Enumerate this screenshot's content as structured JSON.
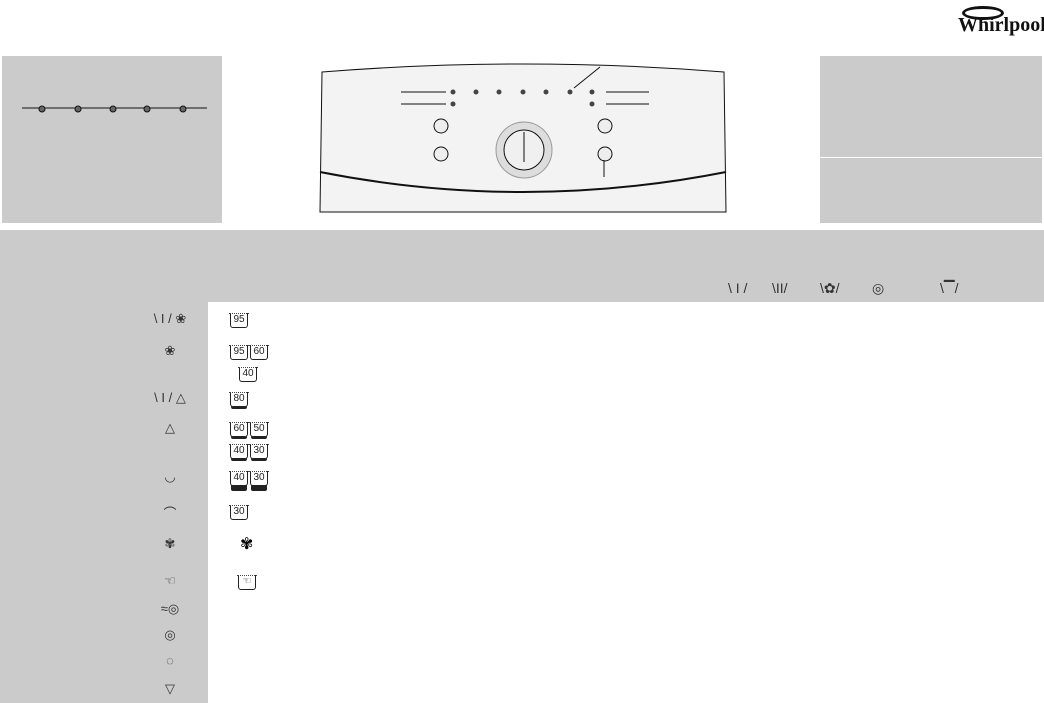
{
  "logo": {
    "text": "Whirlpool"
  },
  "program_rows": [
    {
      "icon": "cotton-prewash-icon",
      "temps": [
        [
          "95"
        ]
      ],
      "bar": ""
    },
    {
      "icon": "cotton-icon",
      "temps": [
        [
          "95",
          "60"
        ],
        [
          "40"
        ]
      ],
      "bar": ""
    },
    {
      "icon": "synthetics-prewash-icon",
      "temps": [
        [
          "80"
        ]
      ],
      "bar": "bar"
    },
    {
      "icon": "synthetics-icon",
      "temps": [
        [
          "60",
          "50"
        ],
        [
          "40",
          "30"
        ]
      ],
      "bar": "bar"
    },
    {
      "icon": "delicates-icon",
      "temps": [
        [
          "40",
          "30"
        ]
      ],
      "bar": "bar2"
    },
    {
      "icon": "quick-wash-icon",
      "temps": [
        [
          "30"
        ]
      ],
      "bar": ""
    },
    {
      "icon": "wool-icon",
      "temps": [],
      "bar": ""
    },
    {
      "icon": "hand-wash-icon",
      "temps": [],
      "bar": ""
    },
    {
      "icon": "rinse-spin-icon",
      "temps": [],
      "bar": ""
    },
    {
      "icon": "spin-icon",
      "temps": [],
      "bar": ""
    },
    {
      "icon": "gentle-spin-icon",
      "temps": [],
      "bar": ""
    },
    {
      "icon": "drain-icon",
      "temps": [],
      "bar": ""
    }
  ],
  "header_icons": [
    "prewash-compartment-icon",
    "main-wash-compartment-icon",
    "softener-compartment-icon",
    "spin-icon",
    "drain-icon"
  ]
}
